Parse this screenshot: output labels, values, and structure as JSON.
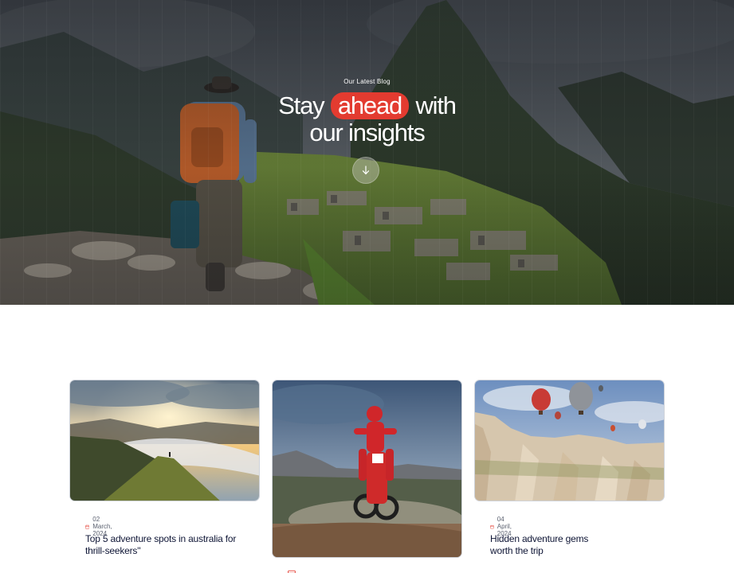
{
  "hero": {
    "eyebrow": "Our Latest Blog",
    "headline_before": "Stay",
    "headline_highlight": "ahead",
    "headline_after": "with",
    "headline_line2": "our insights",
    "scroll_icon": "arrow-down-icon",
    "accent_color": "#e33b30"
  },
  "blog": {
    "posts": [
      {
        "date": "02 March, 2024",
        "title": "Top 5 adventure spots in australia for thrill-seekers\"",
        "image": "mountain-peak-sunrise-photo"
      },
      {
        "date": "",
        "title": "",
        "image": "motocross-rider-photo"
      },
      {
        "date": "04 April, 2024",
        "title": "Hidden adventure gems worth the trip",
        "image": "hot-air-balloons-photo"
      }
    ],
    "date_icon": "calendar-icon"
  }
}
